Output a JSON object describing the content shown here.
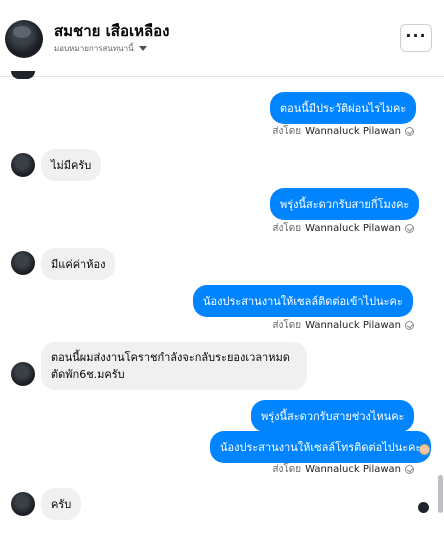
{
  "header": {
    "contact_name": "สมชาย เสือเหลือง",
    "assign_label": "มอบหมายการสนทนานี้",
    "more_label": "···"
  },
  "messages": [
    {
      "direction": "out",
      "text": "ตอนนี้มีประวัติผ่อนไรไมคะ",
      "sent_by_prefix": "ส่งโดย",
      "sent_by_name": "Wannaluck Pilawan"
    },
    {
      "direction": "in",
      "text": "ไม่มีครับ"
    },
    {
      "direction": "out",
      "text": "พรุ่งนี้สะดวกรับสายกี่โมงคะ",
      "sent_by_prefix": "ส่งโดย",
      "sent_by_name": "Wannaluck Pilawan"
    },
    {
      "direction": "in",
      "text": "มีแค่ค่าห้อง"
    },
    {
      "direction": "out",
      "text": "น้องประสานงานให้เซลล์ติดต่อเข้าไปนะคะ",
      "sent_by_prefix": "ส่งโดย",
      "sent_by_name": "Wannaluck Pilawan"
    },
    {
      "direction": "in",
      "text": "ตอนนี้ผมส่งงานโคราชกำลังจะกลับระยองเวลาหมดตัดพัก6ช.มครับ"
    },
    {
      "direction": "out",
      "text": "พรุ่งนี้สะดวกรับสายช่วงไหนคะ"
    },
    {
      "direction": "out",
      "text": "น้องประสานงานให้เซลล์โทรติดต่อไปนะคะ",
      "sent_by_prefix": "ส่งโดย",
      "sent_by_name": "Wannaluck Pilawan"
    },
    {
      "direction": "in",
      "text": "ครับ"
    }
  ],
  "colors": {
    "outgoing_bubble": "#0084ff",
    "incoming_bubble": "#f0f0f0",
    "secondary_text": "#65676b"
  },
  "icons": {
    "more": "ellipsis-icon",
    "assign_dropdown": "caret-down-icon",
    "seen": "check-circle-icon"
  }
}
